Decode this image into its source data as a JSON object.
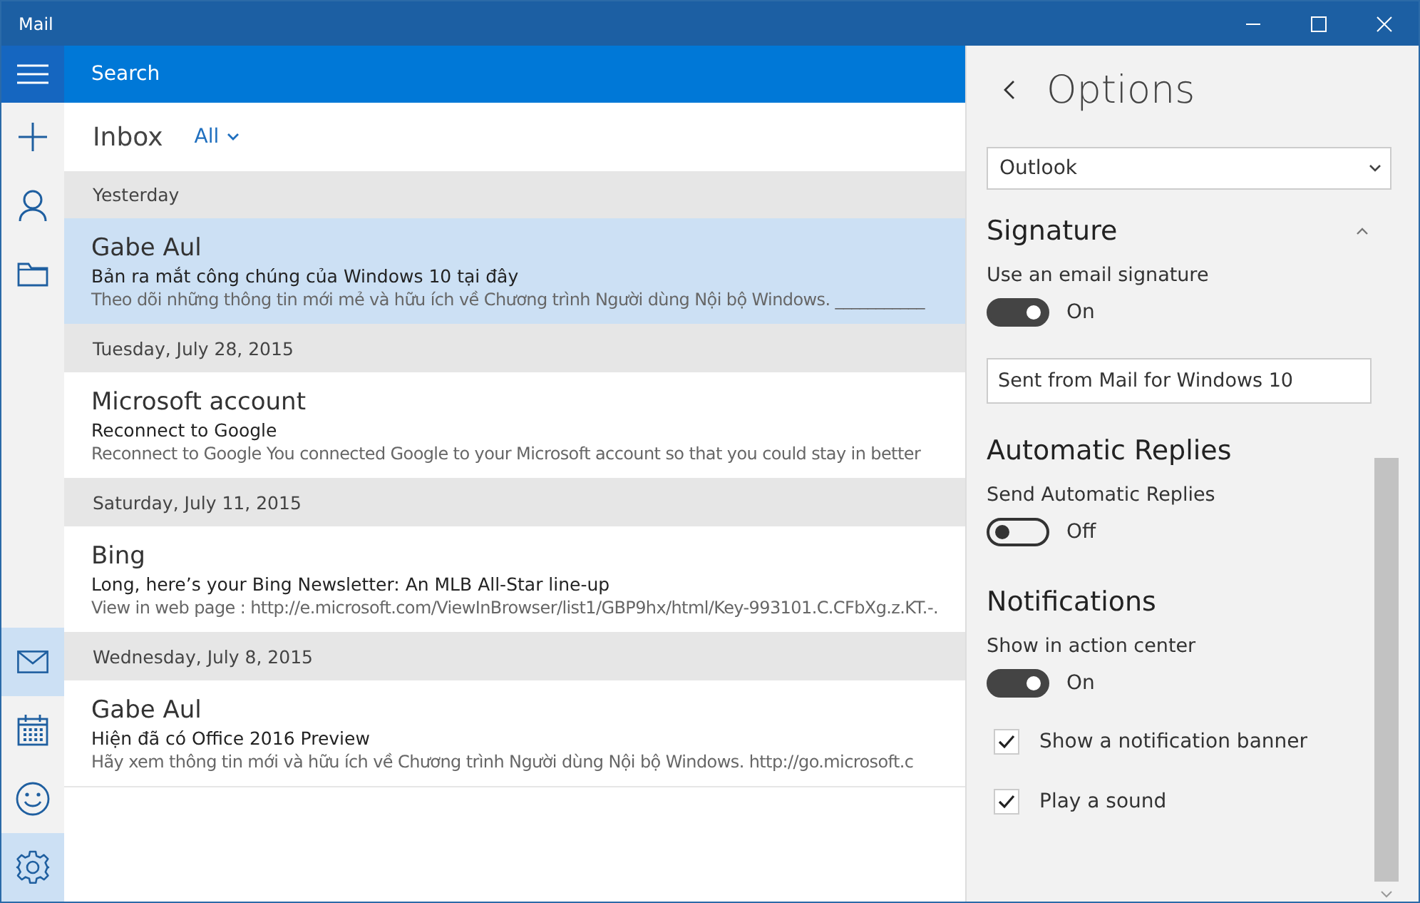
{
  "window": {
    "title": "Mail"
  },
  "search": {
    "placeholder": "Search"
  },
  "nav": [
    {
      "kind": "mail",
      "selected": true
    },
    {
      "kind": "calendar",
      "selected": false
    },
    {
      "kind": "feedback",
      "selected": false
    },
    {
      "kind": "settings",
      "selected": true
    }
  ],
  "folder": {
    "name": "Inbox",
    "filter": "All"
  },
  "groups": [
    {
      "date": "Yesterday",
      "messages": [
        {
          "sender": "Gabe Aul",
          "subject": "Bản ra mắt công chúng của Windows 10 tại đây",
          "preview": "Theo dõi những thông tin mới mẻ và hữu ích về Chương trình Người dùng Nội bộ Windows. ___________",
          "selected": true
        }
      ]
    },
    {
      "date": "Tuesday, July 28, 2015",
      "messages": [
        {
          "sender": "Microsoft account",
          "subject": "Reconnect to Google",
          "preview": "Reconnect to Google You connected Google to your Microsoft account so that you could stay in better",
          "selected": false
        }
      ]
    },
    {
      "date": "Saturday, July 11, 2015",
      "messages": [
        {
          "sender": "Bing",
          "subject": "Long, here’s your Bing Newsletter:  An MLB All-Star line-up",
          "preview": "View in web page : http://e.microsoft.com/ViewInBrowser/list1/GBP9hx/html/Key-993101.C.CFbXg.z.KT.-.",
          "selected": false
        }
      ]
    },
    {
      "date": "Wednesday, July 8, 2015",
      "messages": [
        {
          "sender": "Gabe Aul",
          "subject": "Hiện đã có Office 2016 Preview",
          "preview": "Hãy xem thông tin mới và hữu ích về Chương trình Người dùng Nội bộ Windows. http://go.microsoft.c",
          "selected": false
        }
      ]
    }
  ],
  "options": {
    "title": "Options",
    "account": "Outlook",
    "items": [
      {
        "kind": "heading",
        "text": "Signature",
        "expanded": true
      },
      {
        "kind": "label",
        "text": "Use an email signature"
      },
      {
        "kind": "toggle",
        "on": true,
        "text": "On"
      },
      {
        "kind": "field",
        "value": "Sent from Mail for Windows 10"
      },
      {
        "kind": "heading",
        "text": "Automatic Replies"
      },
      {
        "kind": "label",
        "text": "Send Automatic Replies"
      },
      {
        "kind": "toggle",
        "on": false,
        "text": "Off"
      },
      {
        "kind": "heading",
        "text": "Notifications"
      },
      {
        "kind": "label",
        "text": "Show in action center"
      },
      {
        "kind": "toggle",
        "on": true,
        "text": "On"
      },
      {
        "kind": "checkbox",
        "checked": true,
        "text": "Show a notification banner"
      },
      {
        "kind": "checkbox",
        "checked": true,
        "text": "Play a sound"
      }
    ]
  }
}
